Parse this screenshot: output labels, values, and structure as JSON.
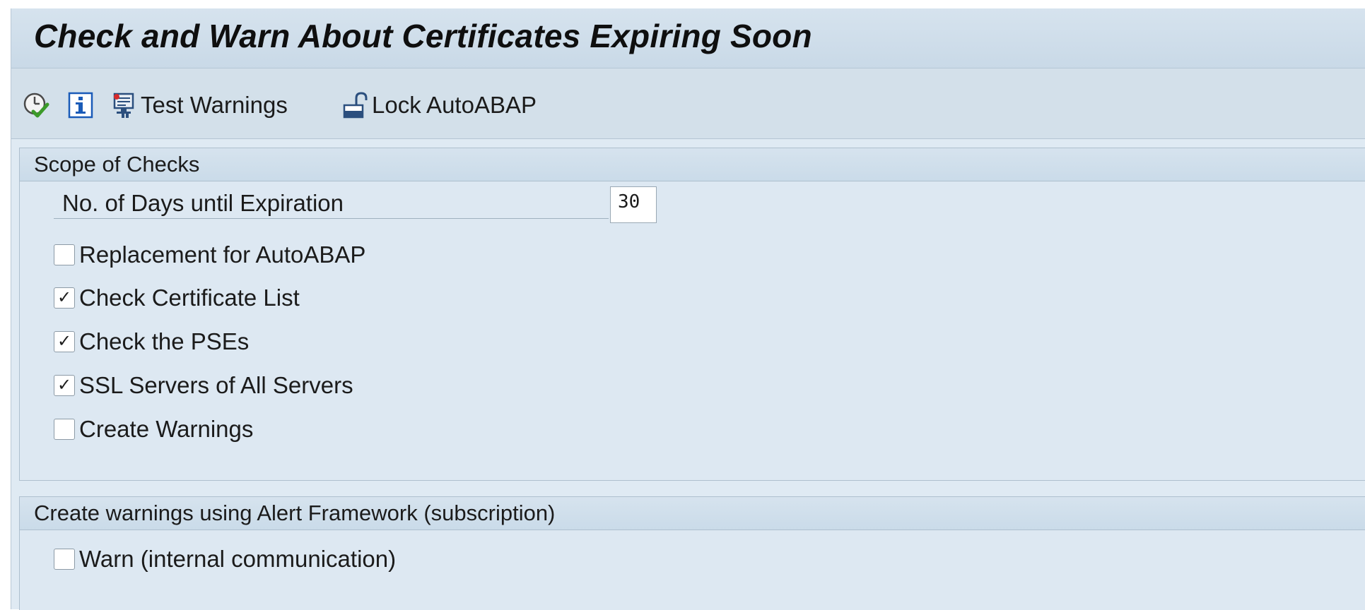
{
  "title": "Check and Warn About Certificates Expiring Soon",
  "toolbar": {
    "execute_icon": "execute-clock-check-icon",
    "info_icon": "info-icon",
    "test_warnings_label": "Test Warnings",
    "test_warnings_icon": "monitor-warning-icon",
    "lock_label": "Lock AutoABAP",
    "lock_icon": "padlock-open-icon"
  },
  "scope": {
    "header": "Scope of Checks",
    "days_label": "No. of Days until Expiration",
    "days_value": "30",
    "checkboxes": [
      {
        "label": "Replacement for AutoABAP",
        "checked": false,
        "mark": ""
      },
      {
        "label": "Check Certificate List",
        "checked": true,
        "mark": "✓"
      },
      {
        "label": "Check the PSEs",
        "checked": true,
        "mark": "✓"
      },
      {
        "label": "SSL Servers of All Servers",
        "checked": true,
        "mark": "✓"
      },
      {
        "label": "Create Warnings",
        "checked": false,
        "mark": ""
      }
    ]
  },
  "alert": {
    "header": "Create warnings using Alert Framework (subscription)",
    "checkboxes": [
      {
        "label": "Warn (internal communication)",
        "checked": false,
        "mark": ""
      }
    ]
  },
  "colors": {
    "background": "#dfeaf3",
    "header_bg": "#cadbe9",
    "info_blue": "#1a5bb8",
    "check_green": "#3c9a2a"
  }
}
